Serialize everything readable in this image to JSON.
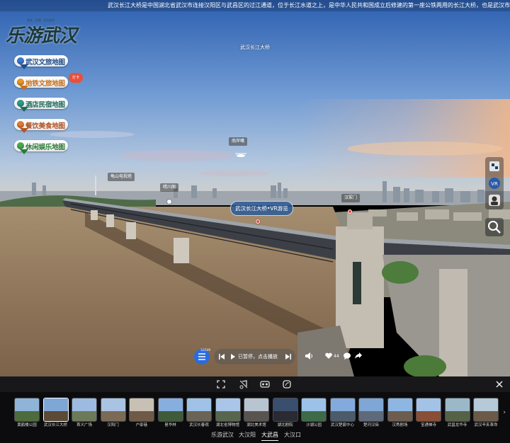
{
  "marquee": "武汉长江大桥是中国湖北省武汉市连接汉阳区与武昌区的过江通道，位于长江水道之上，是中华人民共和国成立后修建的第一座公铁两用的长江大桥，也是武汉市重要的历史标志性建筑之一",
  "logo": {
    "main": "乐游武汉",
    "sub": "吃住 · 乐购 · 乐在其中"
  },
  "menu": [
    {
      "label": "武汉文旅地图",
      "color": "#1e4d8c",
      "dot": "#3a78c8"
    },
    {
      "label": "地铁文旅地图",
      "color": "#c8701a",
      "dot": "#e99426",
      "badge": "打卡"
    },
    {
      "label": "酒店民宿地图",
      "color": "#1f6b5a",
      "dot": "#2d9b82"
    },
    {
      "label": "餐饮美食地图",
      "color": "#b25422",
      "dot": "#e07b35"
    },
    {
      "label": "休闲娱乐地图",
      "color": "#2b7a33",
      "dot": "#49a94f"
    }
  ],
  "scene_title": "武汉长江大桥",
  "hotspots": {
    "south_gate": "南岸嘴",
    "tv_tower": "龟山电视塔",
    "qingchuan": "晴川阁",
    "main": "武汉长江大桥•VR游览",
    "hankou": "汉冢门"
  },
  "player": {
    "counter": "12/149",
    "status": "已暂停，点击播放",
    "likes": "44"
  },
  "thumbs": [
    {
      "caption": "黄鹤楼公园",
      "sky": "#8fb4d8",
      "ground": "#4d6b3d"
    },
    {
      "caption": "武汉长江大桥",
      "sky": "#7ea7d6",
      "ground": "#5b4a36",
      "active": true
    },
    {
      "caption": "首义广场",
      "sky": "#9dbbe0",
      "ground": "#6d7a5a"
    },
    {
      "caption": "汉阳门",
      "sky": "#a9c3e2",
      "ground": "#7b6a55"
    },
    {
      "caption": "户部巷",
      "sky": "#c8c0b4",
      "ground": "#6f5a48"
    },
    {
      "caption": "昙华林",
      "sky": "#86afe0",
      "ground": "#3f5b3a"
    },
    {
      "caption": "武汉长春观",
      "sky": "#9fc2e6",
      "ground": "#6a6456"
    },
    {
      "caption": "湖北省博物馆",
      "sky": "#a9c6e8",
      "ground": "#58664e"
    },
    {
      "caption": "湖北美术馆",
      "sky": "#b8c4cf",
      "ground": "#5a5450"
    },
    {
      "caption": "湖北剧院",
      "sky": "#3a4f6e",
      "ground": "#2a2a33"
    },
    {
      "caption": "沙湖公园",
      "sky": "#9cc2e8",
      "ground": "#3f6a48"
    },
    {
      "caption": "武汉楚宸中心",
      "sky": "#82aadc",
      "ground": "#4c5b6a"
    },
    {
      "caption": "楚河汉街",
      "sky": "#7fa6d4",
      "ground": "#5e6a7a"
    },
    {
      "caption": "汉秀剧场",
      "sky": "#8db7e2",
      "ground": "#6d5d4f"
    },
    {
      "caption": "宝通禅寺",
      "sky": "#a2c3e6",
      "ground": "#8a4e36"
    },
    {
      "caption": "武昌龙华寺",
      "sky": "#9ab8c8",
      "ground": "#566247"
    },
    {
      "caption": "武汉辛亥革命",
      "sky": "#b5c9d8",
      "ground": "#6a5a47"
    }
  ],
  "groups": [
    {
      "label": "乐游武汉"
    },
    {
      "label": "大汉阳"
    },
    {
      "label": "大武昌",
      "active": true
    },
    {
      "label": "大汉口"
    }
  ]
}
